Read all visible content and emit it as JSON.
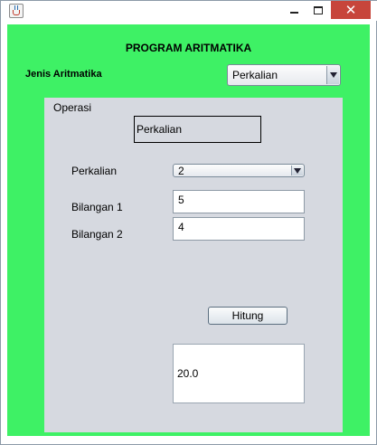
{
  "titlebar": {
    "icons": {
      "app": "java-cup-icon",
      "minimize": "minimize-icon",
      "maximize": "maximize-icon",
      "close": "close-icon"
    },
    "close_glyph": "✕"
  },
  "colors": {
    "content_bg": "#3ef165",
    "panel_bg": "#d6d9e0",
    "close_bg": "#c7453b"
  },
  "form": {
    "title": "PROGRAM ARITMATIKA",
    "jenis_label": "Jenis Aritmatika",
    "jenis_selected": "Perkalian"
  },
  "panel": {
    "label": "Operasi",
    "operation_display": "Perkalian",
    "perkalian_label": "Perkalian",
    "perkalian_selected": "2",
    "bilangan1_label": "Bilangan 1",
    "bilangan1_value": "5",
    "bilangan2_label": "Bilangan 2",
    "bilangan2_value": "4",
    "hitung_label": "Hitung",
    "result_value": "20.0"
  }
}
